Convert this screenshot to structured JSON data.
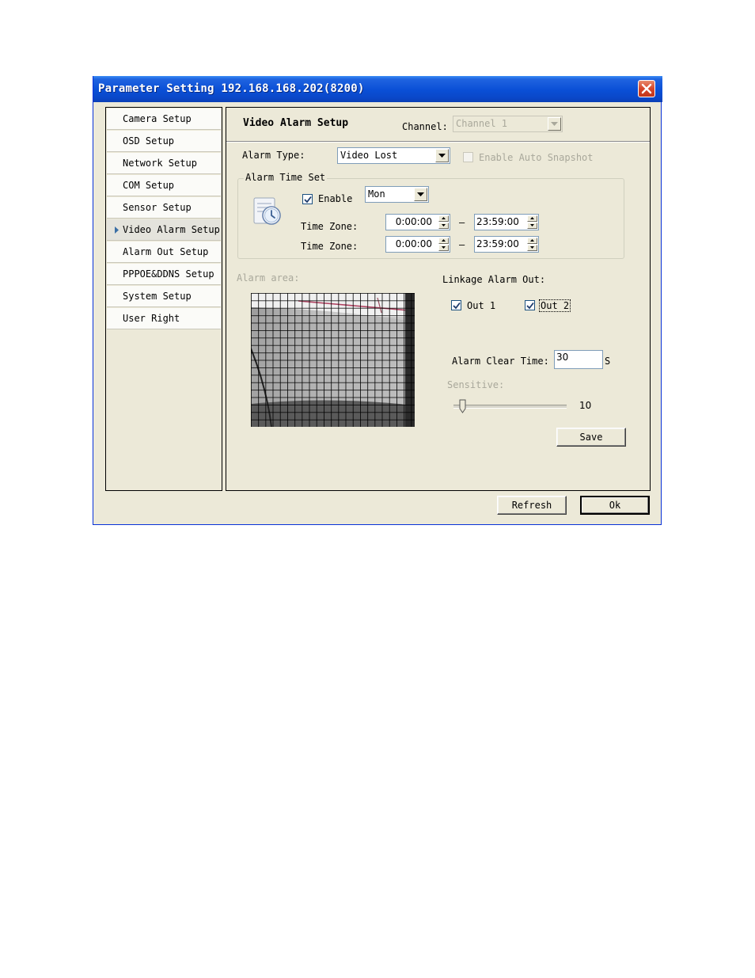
{
  "window": {
    "title": "Parameter Setting 192.168.168.202(8200)"
  },
  "sidebar": {
    "items": [
      {
        "label": "Camera Setup",
        "active": false
      },
      {
        "label": "OSD Setup",
        "active": false
      },
      {
        "label": "Network Setup",
        "active": false
      },
      {
        "label": "COM Setup",
        "active": false
      },
      {
        "label": "Sensor Setup",
        "active": false
      },
      {
        "label": "Video Alarm Setup",
        "active": true
      },
      {
        "label": "Alarm Out Setup",
        "active": false
      },
      {
        "label": "PPPOE&DDNS Setup",
        "active": false
      },
      {
        "label": "System Setup",
        "active": false
      },
      {
        "label": "User Right",
        "active": false
      }
    ]
  },
  "main": {
    "title": "Video Alarm Setup",
    "channel_label": "Channel:",
    "channel_value": "Channel 1",
    "alarm_type_label": "Alarm Type:",
    "alarm_type_value": "Video Lost",
    "auto_snapshot_label": "Enable Auto Snapshot",
    "alarm_time_set": {
      "group_label": "Alarm Time Set",
      "enable_label": "Enable",
      "enable_checked": true,
      "day_value": "Mon",
      "time_zone_label": "Time Zone:",
      "zones": [
        {
          "start": "0:00:00",
          "end": "23:59:00"
        },
        {
          "start": "0:00:00",
          "end": "23:59:00"
        }
      ],
      "dash": "–"
    },
    "alarm_area_label": "Alarm area:",
    "linkage_label": "Linkage Alarm Out:",
    "out1_label": "Out 1",
    "out2_label": "Out 2",
    "alarm_clear_label": "Alarm Clear Time:",
    "alarm_clear_value": "30",
    "alarm_clear_unit": "S",
    "sensitive_label": "Sensitive:",
    "sensitive_value": "10",
    "save_label": "Save"
  },
  "footer": {
    "refresh_label": "Refresh",
    "ok_label": "Ok"
  },
  "colors": {
    "titlebar": "#0a4fd6",
    "dialog_bg": "#ece9d8",
    "close_button": "#d6462a"
  }
}
